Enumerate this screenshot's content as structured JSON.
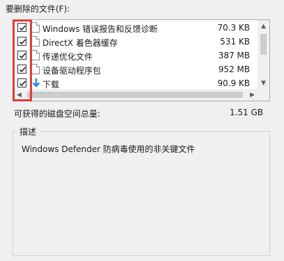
{
  "files_label": "要删除的文件(F):",
  "files": [
    {
      "name": "Windows 错误报告和反馈诊断",
      "size": "70.3 KB",
      "checked": true,
      "icon": "file-icon"
    },
    {
      "name": "DirectX 着色器缓存",
      "size": "531 KB",
      "checked": true,
      "icon": "file-icon"
    },
    {
      "name": "传递优化文件",
      "size": "387 MB",
      "checked": true,
      "icon": "file-icon"
    },
    {
      "name": "设备驱动程序包",
      "size": "952 MB",
      "checked": true,
      "icon": "file-icon"
    },
    {
      "name": "下载",
      "size": "90.9 KB",
      "checked": true,
      "icon": "download-icon"
    }
  ],
  "space_label": "可获得的磁盘空间总量:",
  "space_value": "1.51 GB",
  "description_title": "描述",
  "description_text": "Windows Defender 防病毒使用的非关键文件",
  "colors": {
    "highlight": "#e53935",
    "download_arrow": "#1e88e5"
  }
}
